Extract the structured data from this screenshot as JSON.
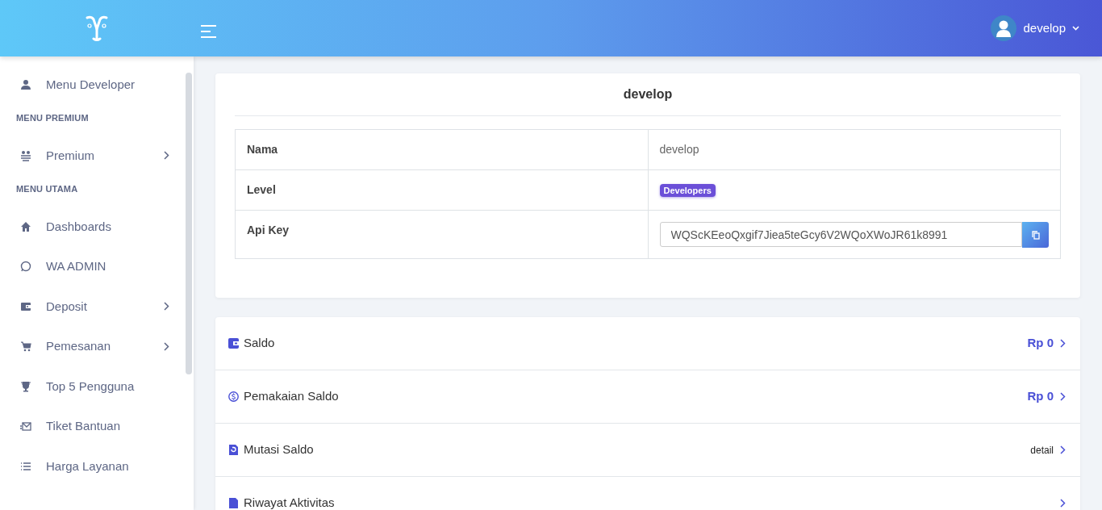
{
  "header": {
    "user": "develop"
  },
  "sidebar": {
    "items": [
      {
        "kind": "link",
        "label": "Menu Developer",
        "has_submenu": false
      },
      {
        "kind": "heading",
        "label": "MENU PREMIUM"
      },
      {
        "kind": "link",
        "label": "Premium",
        "has_submenu": true
      },
      {
        "kind": "heading",
        "label": "MENU UTAMA"
      },
      {
        "kind": "link",
        "label": "Dashboards",
        "has_submenu": false
      },
      {
        "kind": "link",
        "label": "WA ADMIN",
        "has_submenu": false
      },
      {
        "kind": "link",
        "label": "Deposit",
        "has_submenu": true
      },
      {
        "kind": "link",
        "label": "Pemesanan",
        "has_submenu": true
      },
      {
        "kind": "link",
        "label": "Top 5 Pengguna",
        "has_submenu": false
      },
      {
        "kind": "link",
        "label": "Tiket Bantuan",
        "has_submenu": false
      },
      {
        "kind": "link",
        "label": "Harga Layanan",
        "has_submenu": false
      }
    ]
  },
  "profile": {
    "title": "develop",
    "rows": [
      {
        "kind": "text",
        "label": "Nama",
        "value": "develop"
      },
      {
        "kind": "badge",
        "label": "Level",
        "value": "Developers"
      },
      {
        "kind": "copy",
        "label": "Api Key",
        "value": "WQScKEeoQxgif7Jiea5teGcy6V2WQoXWoJR61k8991"
      }
    ]
  },
  "balance_list": [
    {
      "label": "Saldo",
      "value": "Rp 0",
      "emphasis": true
    },
    {
      "label": "Pemakaian Saldo",
      "value": "Rp 0",
      "emphasis": true
    },
    {
      "label": "Mutasi Saldo",
      "value": "detail",
      "emphasis": false
    },
    {
      "label": "Riwayat Aktivitas"
    }
  ]
}
